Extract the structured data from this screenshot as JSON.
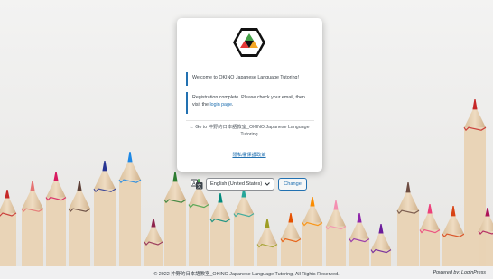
{
  "login": {
    "welcome_message": "Welcome to OKINO Japanese Language Tutoring!",
    "registration_message": "Registration complete. Please check your email, then visit the",
    "login_link": "login page",
    "registration_suffix": ".",
    "back_link_prefix": "← Go to 沖野的日本語教室_OKINO Japanese Language Tutoring",
    "privacy_link": "隱私權保護政策"
  },
  "language": {
    "selected": "English (United States)",
    "change_button": "Change"
  },
  "footer": {
    "copyright": "© 2022 沖野的日本語教室_OKINO Japanese Language Tutoring, All Rights Reserved.",
    "powered_by": "Powered by: LoginPress"
  },
  "icons": [
    "site-logo-icon",
    "translate-icon",
    "chevron-down-icon"
  ],
  "colors": {
    "accent": "#2271b1",
    "logo_green": "#4caf50",
    "logo_orange": "#f5a623",
    "logo_red": "#e53935"
  }
}
